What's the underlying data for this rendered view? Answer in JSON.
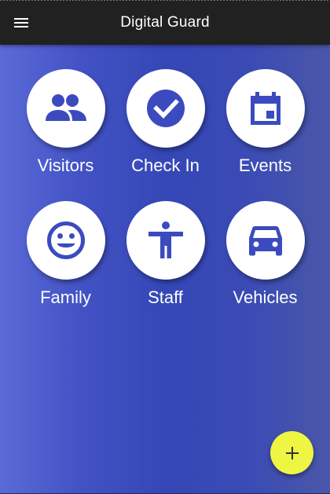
{
  "app_bar": {
    "title": "Digital Guard",
    "menu_icon": "menu-icon"
  },
  "tiles": [
    {
      "label": "Visitors",
      "icon": "people-icon"
    },
    {
      "label": "Check In",
      "icon": "check-circle-icon"
    },
    {
      "label": "Events",
      "icon": "calendar-icon"
    },
    {
      "label": "Family",
      "icon": "smiley-face-icon"
    },
    {
      "label": "Staff",
      "icon": "person-accessibility-icon"
    },
    {
      "label": "Vehicles",
      "icon": "car-icon"
    }
  ],
  "fab": {
    "icon": "plus-icon"
  },
  "colors": {
    "app_bar": "#212121",
    "icon_blue": "#3b4bbf",
    "background_gradient_mid": "#3547b7",
    "fab": "#eef542"
  }
}
